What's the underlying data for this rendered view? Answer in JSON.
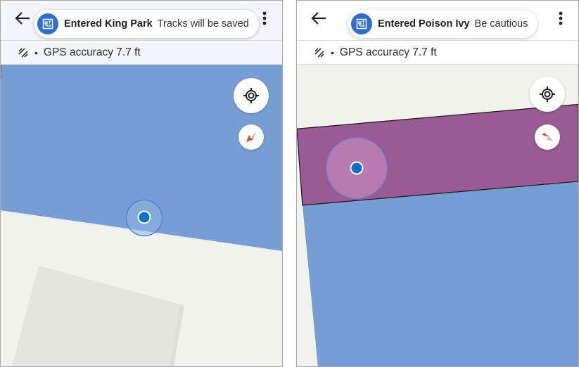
{
  "screens": [
    {
      "id": "left",
      "toast": {
        "icon": "park-area-icon",
        "title": "Entered King Park",
        "message": "Tracks will be saved"
      },
      "status": {
        "icon": "gps-signal-icon",
        "separator": "•",
        "text": "GPS accuracy 7.7 ft"
      },
      "buttons": {
        "back": "back-arrow-icon",
        "menu": "more-vert-icon",
        "locate": "my-location-icon",
        "compass": "compass-icon"
      },
      "map": {
        "area_name": "King Park",
        "area_color": "#769dd4",
        "background_color": "#f2f2ec",
        "building_color": "#e5e5df",
        "location_dot_color": "#0b72c8"
      }
    },
    {
      "id": "right",
      "toast": {
        "icon": "park-area-icon",
        "title": "Entered Poison Ivy",
        "message": "Be cautious"
      },
      "status": {
        "icon": "gps-signal-icon",
        "separator": "•",
        "text": "GPS accuracy 7.7 ft"
      },
      "buttons": {
        "back": "back-arrow-icon",
        "search": "search-icon",
        "menu": "more-vert-icon",
        "locate": "my-location-icon",
        "compass": "compass-icon"
      },
      "map": {
        "area_name": "Poison Ivy",
        "area_color": "#9a5a93",
        "park_color": "#769dd4",
        "background_color": "#f2f2ec",
        "location_dot_color": "#0b72c8"
      }
    }
  ]
}
